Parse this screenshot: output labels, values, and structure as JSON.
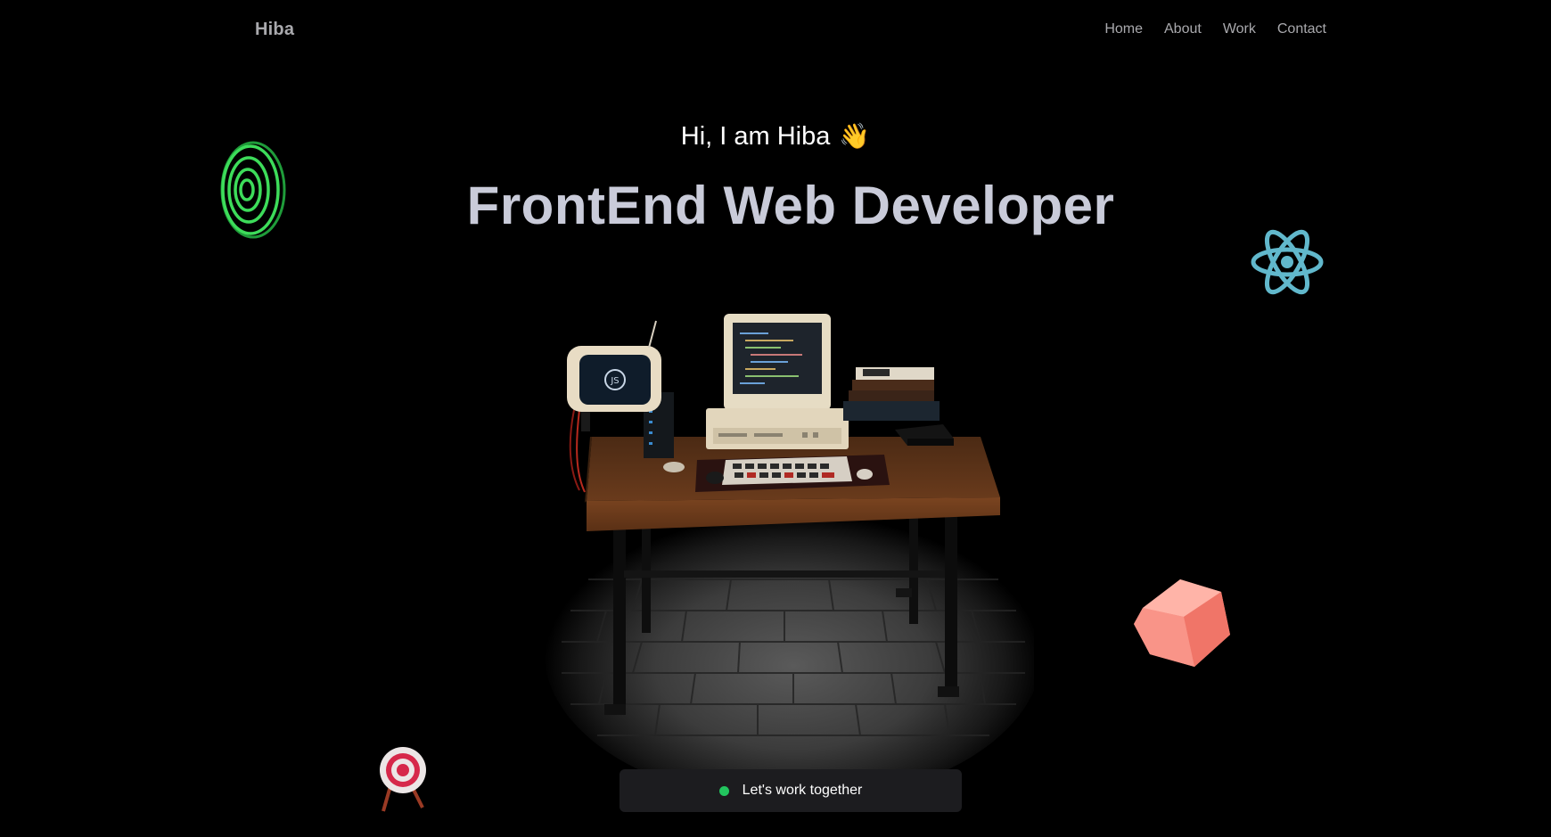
{
  "nav": {
    "logo": "Hiba",
    "links": [
      "Home",
      "About",
      "Work",
      "Contact"
    ]
  },
  "hero": {
    "greeting": "Hi, I am Hiba",
    "wave_emoji": "👋",
    "headline": "FrontEnd Web Developer",
    "cta_label": "Let's work together",
    "cta_status_color": "#22c55e"
  },
  "icons": {
    "top_left": "concentric-rings-icon",
    "top_right": "react-icon",
    "bottom_left": "target-icon",
    "bottom_right": "cube-icon",
    "center": "computer-desk-scene"
  },
  "colors": {
    "background": "#000000",
    "headline": "#c9cbd9",
    "nav_text": "#a9a9ad",
    "react": "#61b8cc",
    "rings": "#3ddc5a",
    "cube": "#f7877d"
  }
}
